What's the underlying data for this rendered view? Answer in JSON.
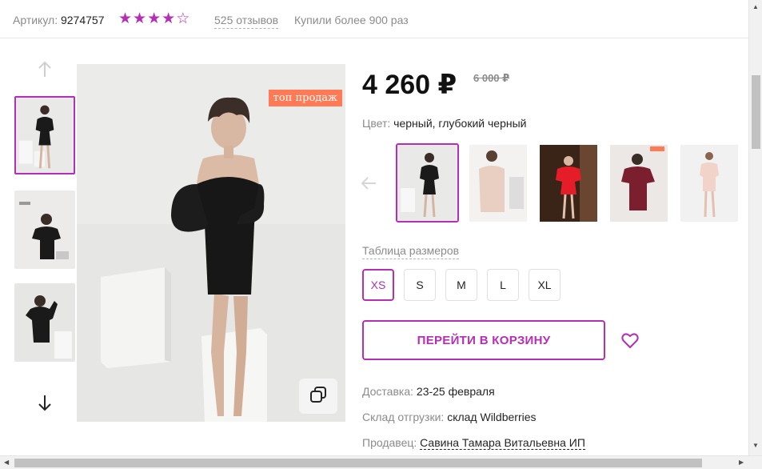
{
  "meta": {
    "sku_label": "Артикул:",
    "sku_value": "9274757",
    "rating_stars": 4,
    "rating_max": 5,
    "reviews": "525 отзывов",
    "bought": "Купили более 900 раз"
  },
  "gallery": {
    "badge": "топ продаж",
    "thumbs": [
      "photo-1",
      "photo-2",
      "photo-3"
    ],
    "active_thumb": 0
  },
  "product": {
    "price": "4 260 ₽",
    "old_price": "6 000 ₽",
    "color_label": "Цвет:",
    "color_value": "черный, глубокий черный",
    "size_table": "Таблица размеров",
    "sizes": [
      "XS",
      "S",
      "M",
      "L",
      "XL"
    ],
    "selected_size": "XS",
    "cart_button": "ПЕРЕЙТИ В КОРЗИНУ"
  },
  "delivery": {
    "delivery_label": "Доставка:",
    "delivery_value": "23-25 февраля",
    "warehouse_label": "Склад отгрузки:",
    "warehouse_value": "склад Wildberries",
    "seller_label": "Продавец:",
    "seller_value": "Савина Тамара Витальевна ИП"
  },
  "colors": {
    "accent": "#b62db6",
    "badge": "#ff7a55"
  }
}
